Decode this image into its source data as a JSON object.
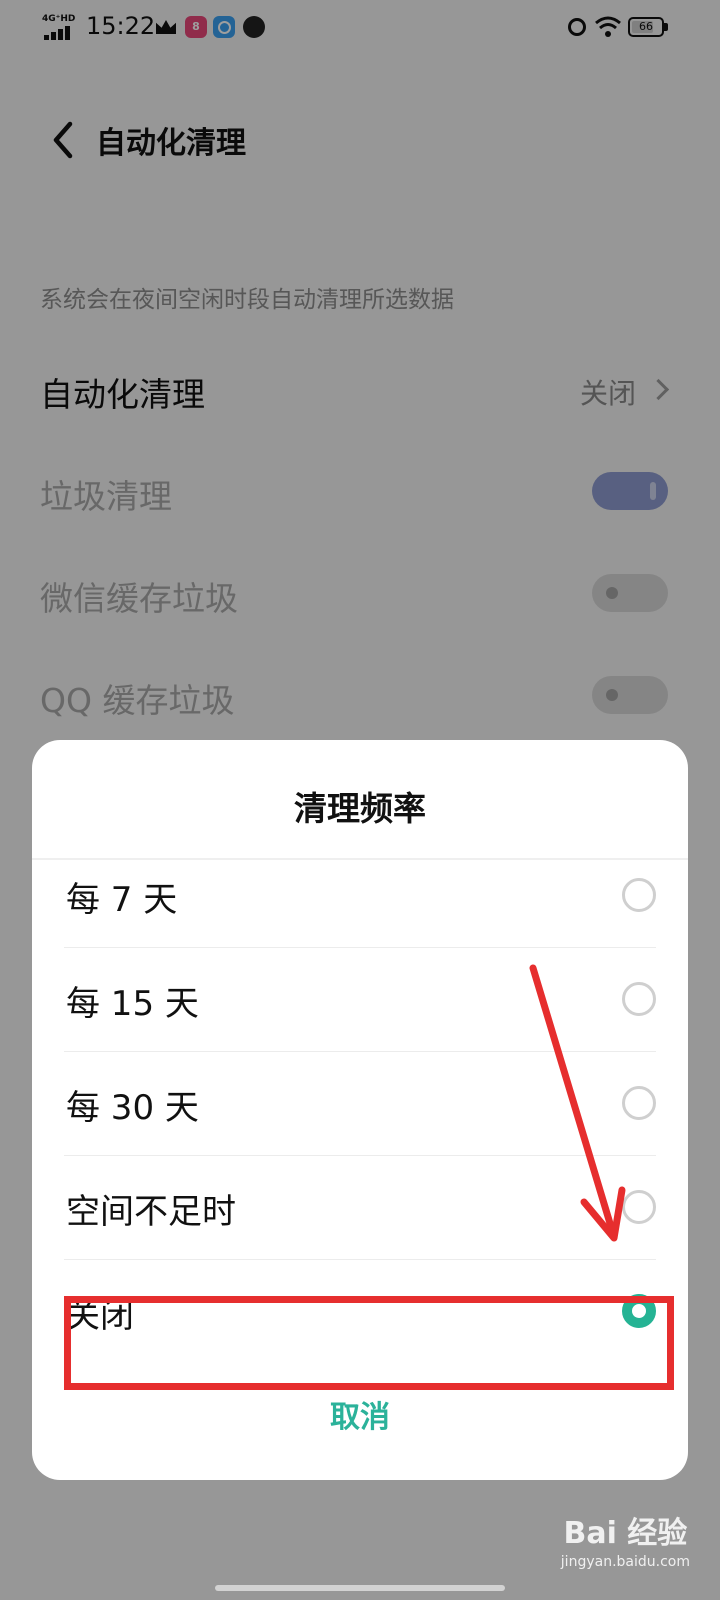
{
  "status_bar": {
    "network": "4G⁺HD",
    "time": "15:22",
    "app_badge": "8",
    "battery": "66"
  },
  "header": {
    "title": "自动化清理"
  },
  "settings": {
    "description": "系统会在夜间空闲时段自动清理所选数据",
    "auto_clean": {
      "label": "自动化清理",
      "value": "关闭"
    },
    "junk_clean": {
      "label": "垃圾清理",
      "enabled": true
    },
    "wechat_cache": {
      "label": "微信缓存垃圾",
      "enabled": false
    },
    "qq_cache": {
      "label": "QQ 缓存垃圾",
      "enabled": false
    }
  },
  "dialog": {
    "title": "清理频率",
    "options": [
      {
        "label": "每 7 天",
        "selected": false
      },
      {
        "label": "每 15 天",
        "selected": false
      },
      {
        "label": "每 30 天",
        "selected": false
      },
      {
        "label": "空间不足时",
        "selected": false
      },
      {
        "label": "关闭",
        "selected": true
      }
    ],
    "cancel_label": "取消"
  },
  "watermark": {
    "main": "Bai 经验",
    "sub": "jingyan.baidu.com"
  },
  "colors": {
    "accent": "#25b394",
    "annotation": "#e62e2e"
  }
}
